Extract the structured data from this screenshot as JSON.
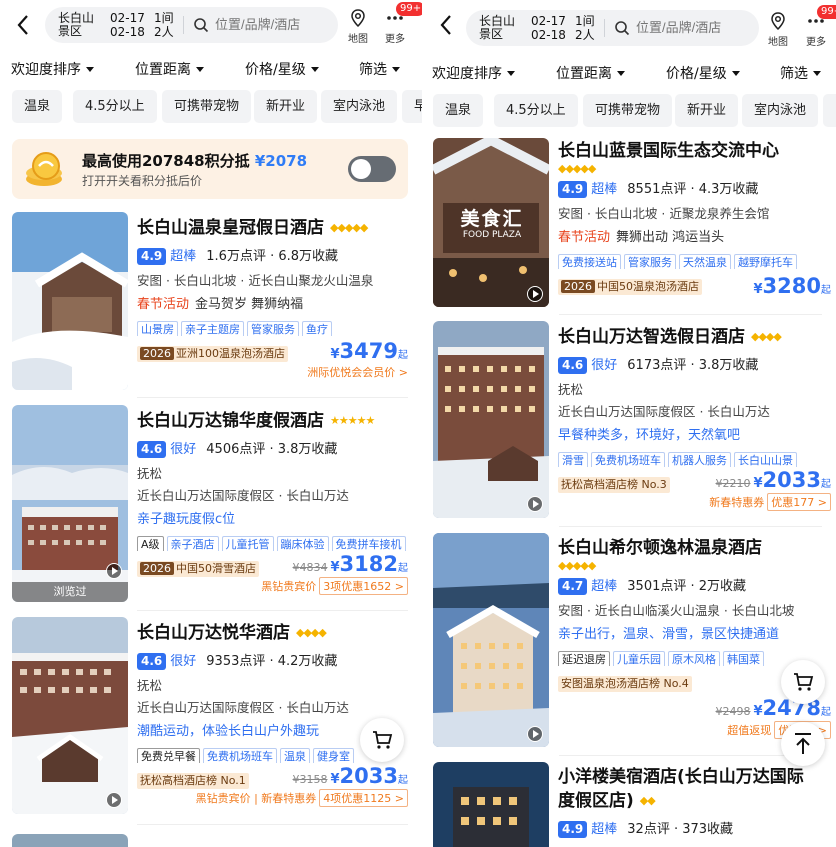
{
  "header": {
    "destination": "长白山景区",
    "checkin": "02-17",
    "checkout": "02-18",
    "rooms": "1间",
    "guests": "2人",
    "search_placeholder": "位置/品牌/酒店",
    "map_label": "地图",
    "more_label": "更多",
    "more_badge": "99+"
  },
  "filters": [
    "欢迎度排序",
    "位置距离",
    "价格/星级",
    "筛选"
  ],
  "quick_tags": [
    "温泉",
    "4.5分以上",
    "可携带宠物",
    "新开业",
    "室内泳池",
    "早"
  ],
  "points_banner": {
    "text": "最高使用207848积分抵",
    "amount": "¥2078",
    "sub": "打开开关看积分抵后价"
  },
  "left_hotels": [
    {
      "name": "长白山温泉皇冠假日酒店",
      "stars": "◆◆◆◆◆",
      "score": "4.9",
      "score_label": "超棒",
      "reviews": "1.6万点评 · 6.8万收藏",
      "location": "安图 · 长白山北坡 · 近长白山聚龙火山温泉",
      "hl_red": "春节活动",
      "hl_gray": "金马贺岁  舞狮纳福",
      "chips": [
        "山景房",
        "亲子主题房",
        "管家服务",
        "鱼疗"
      ],
      "rank_year": "2026",
      "rank": "亚洲100温泉泡汤酒店",
      "orig": "",
      "price": "3479",
      "qi": "起",
      "promo": "洲际优悦会会员价 >",
      "promo_extra": ""
    },
    {
      "name": "长白山万达锦华度假酒店",
      "stars": "★★★★★",
      "score": "4.6",
      "score_label": "很好",
      "reviews": "4506点评 · 3.8万收藏",
      "location_line1": "抚松",
      "location": "近长白山万达国际度假区 · 长白山万达",
      "hl_blue": "亲子趣玩度假c位",
      "chips": [
        "A级",
        "亲子酒店",
        "儿童托管",
        "蹦床体验",
        "免费拼车接机"
      ],
      "rank_year": "2026",
      "rank": "中国50滑雪酒店",
      "orig": "¥4834",
      "price": "3182",
      "qi": "起",
      "promo": "黑钻贵宾价",
      "promo_extra": "3项优惠1652 >",
      "viewed": "浏览过"
    },
    {
      "name": "长白山万达悦华酒店",
      "stars": "◆◆◆◆",
      "score": "4.6",
      "score_label": "很好",
      "reviews": "9353点评 · 4.2万收藏",
      "location_line1": "抚松",
      "location": "近长白山万达国际度假区 · 长白山万达",
      "hl_blue": "潮酷运动，体验长白山户外趣玩",
      "chips": [
        "免费兑早餐",
        "免费机场班车",
        "温泉",
        "健身室"
      ],
      "rank": "抚松高档酒店榜 No.1",
      "orig": "¥3158",
      "price": "2033",
      "qi": "起",
      "promo": "黑钻贵宾价 | 新春特惠券",
      "promo_extra": "4项优惠1125 >"
    }
  ],
  "right_hotels": [
    {
      "name": "长白山蓝景国际生态交流中心",
      "stars": "◆◆◆◆◆",
      "score": "4.9",
      "score_label": "超棒",
      "reviews": "8551点评 · 4.3万收藏",
      "location": "安图 · 长白山北坡 · 近聚龙泉养生会馆",
      "hl_red": "春节活动",
      "hl_gray": "舞狮出动  鸿运当头",
      "chips": [
        "免费接送站",
        "管家服务",
        "天然温泉",
        "越野摩托车"
      ],
      "rank_year": "2026",
      "rank": "中国50温泉泡汤酒店",
      "orig": "",
      "price": "3280",
      "qi": "起",
      "sign": "美食汇",
      "sign_sub": "FOOD PLAZA"
    },
    {
      "name": "长白山万达智选假日酒店",
      "stars": "◆◆◆◆",
      "score": "4.6",
      "score_label": "很好",
      "reviews": "6173点评 · 3.8万收藏",
      "location_line1": "抚松",
      "location": "近长白山万达国际度假区 · 长白山万达",
      "hl_blue": "早餐种类多，环境好，天然氧吧",
      "chips": [
        "滑雪",
        "免费机场班车",
        "机器人服务",
        "长白山山景"
      ],
      "rank": "抚松高档酒店榜 No.3",
      "orig": "¥2210",
      "price": "2033",
      "qi": "起",
      "promo": "新春特惠券",
      "promo_extra": "优惠177 >"
    },
    {
      "name": "长白山希尔顿逸林温泉酒店",
      "stars": "◆◆◆◆◆",
      "score": "4.7",
      "score_label": "超棒",
      "reviews": "3501点评 · 2万收藏",
      "location": "安图 · 近长白山临溪火山温泉 · 长白山北坡",
      "hl_blue": "亲子出行，温泉、滑雪，景区快捷通道",
      "chips": [
        "延迟退房",
        "儿童乐园",
        "原木风格",
        "韩国菜"
      ],
      "rank": "安图温泉泡汤酒店榜 No.4",
      "orig": "¥2498",
      "price": "2478",
      "qi": "起",
      "promo": "超值返现",
      "promo_extra": "优惠20 >"
    },
    {
      "name": "小洋楼美宿酒店(长白山万达国际度假区店)",
      "name_l1": "小洋楼美宿酒店(长白山万达国际",
      "name_l2": "度假区店)",
      "stars": "◆◆",
      "score": "4.9",
      "score_label": "超棒",
      "reviews": "32点评 · 373收藏"
    }
  ],
  "colors": {
    "accent": "#2f6ff0",
    "orange": "#f07a1e",
    "red": "#e8441d",
    "star": "#f5b300"
  }
}
